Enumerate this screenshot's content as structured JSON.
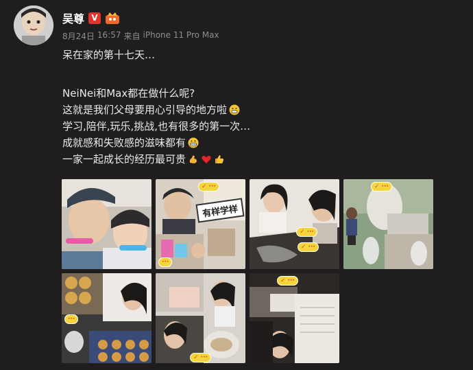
{
  "user": {
    "name": "吴尊",
    "verified_badge": "V",
    "verified_color": "#e2342d"
  },
  "meta": {
    "date": "8月24日",
    "time": "16:57",
    "source_prefix": "来自",
    "device": "iPhone 11 Pro Max"
  },
  "post": {
    "line1": "呆在家的第十七天…",
    "line2": "NeiNei和Max都在做什么呢?",
    "line3": "这就是我们父母要用心引导的地方啦",
    "line4": "学习,陪伴,玩乐,挑战,也有很多的第一次…",
    "line5": "成就感和失败感的滋味都有",
    "line6": "一家一起成长的经历最可贵"
  },
  "photos": {
    "p2_stamp": "有样学样",
    "accent_yellow": "#f5d53c"
  }
}
